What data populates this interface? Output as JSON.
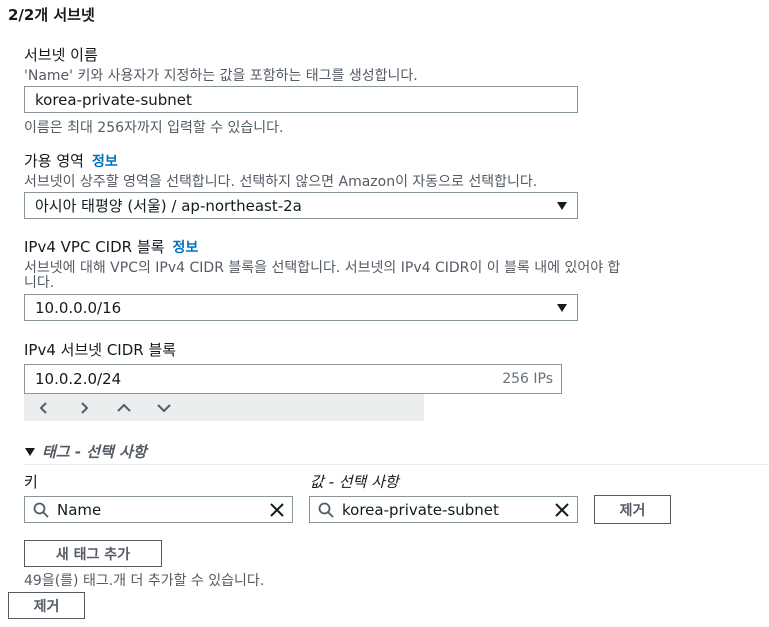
{
  "section_title": "2/2개 서브넷",
  "subnet_name": {
    "label": "서브넷 이름",
    "description": "'Name' 키와 사용자가 지정하는 값을 포함하는 태그를 생성합니다.",
    "value": "korea-private-subnet",
    "constraint": "이름은 최대 256자까지 입력할 수 있습니다."
  },
  "availability_zone": {
    "label": "가용 영역",
    "info": "정보",
    "description": "서브넷이 상주할 영역을 선택합니다. 선택하지 않으면 Amazon이 자동으로 선택합니다.",
    "value": "아시아 태평양 (서울) / ap-northeast-2a"
  },
  "vpc_cidr": {
    "label": "IPv4 VPC CIDR 블록",
    "info": "정보",
    "description_line1": "서브넷에 대해 VPC의 IPv4 CIDR 블록을 선택합니다. 서브넷의 IPv4 CIDR이 이 블록 내에 있어야 합",
    "description_line2": "니다.",
    "value": "10.0.0.0/16"
  },
  "subnet_cidr": {
    "label": "IPv4 서브넷 CIDR 블록",
    "value": "10.0.2.0/24",
    "ip_count": "256 IPs"
  },
  "tags": {
    "header": "태그 - 선택 사항",
    "key_label": "키",
    "value_label": "값 - 선택 사항",
    "rows": [
      {
        "key": "Name",
        "value": "korea-private-subnet",
        "remove_label": "제거"
      }
    ],
    "add_label": "새 태그 추가",
    "limit_text": "49을(를) 태그.개 더 추가할 수 있습니다."
  },
  "remove_subnet_label": "제거",
  "colors": {
    "link": "#0073bb",
    "border": "#879596",
    "muted": "#545b64",
    "stepper_bg": "#eaeded"
  },
  "icons": [
    "chevron-left-icon",
    "chevron-right-icon",
    "chevron-up-icon",
    "chevron-down-icon",
    "caret-down-icon",
    "search-icon",
    "clear-icon"
  ]
}
